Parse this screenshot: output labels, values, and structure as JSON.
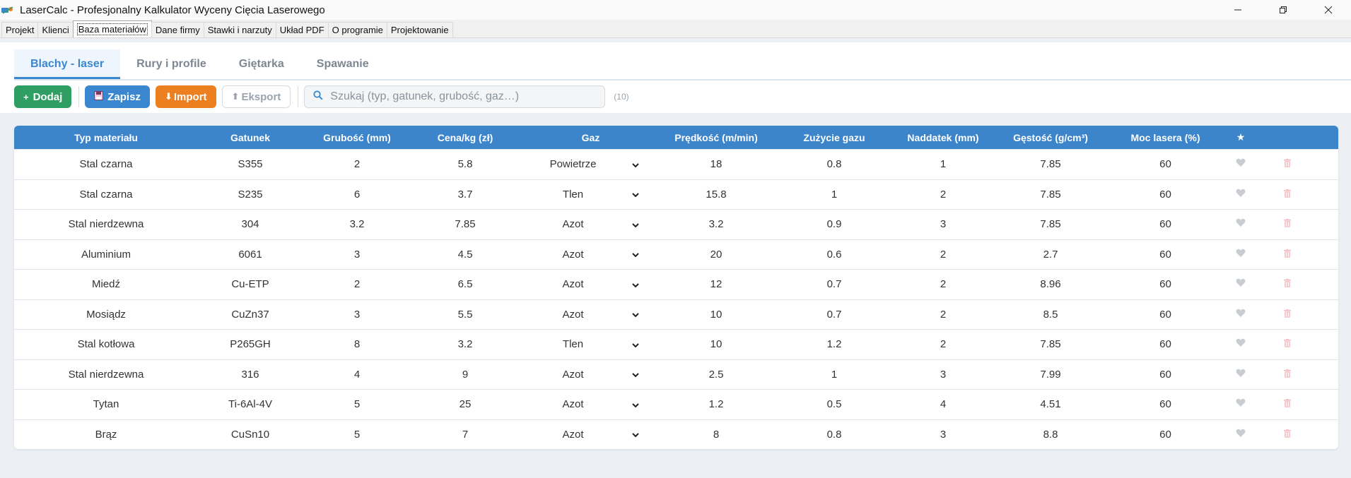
{
  "window": {
    "title": "LaserCalc - Profesjonalny Kalkulator Wyceny Cięcia Laserowego"
  },
  "menu_tabs": [
    {
      "label": "Projekt"
    },
    {
      "label": "Klienci"
    },
    {
      "label": "Baza materiałów",
      "active": true
    },
    {
      "label": "Dane firmy"
    },
    {
      "label": "Stawki i narzuty"
    },
    {
      "label": "Układ PDF"
    },
    {
      "label": "O programie"
    },
    {
      "label": "Projektowanie"
    }
  ],
  "sub_tabs": [
    {
      "label": "Blachy - laser",
      "active": true
    },
    {
      "label": "Rury i profile"
    },
    {
      "label": "Giętarka"
    },
    {
      "label": "Spawanie"
    }
  ],
  "toolbar": {
    "add_label": "Dodaj",
    "save_label": "Zapisz",
    "import_label": "Import",
    "export_label": "Eksport",
    "search_placeholder": "Szukaj (typ, gatunek, grubość, gaz…)",
    "count": "(10)"
  },
  "colors": {
    "accent": "#3d85cb",
    "add": "#2f9e62",
    "import": "#ec7f1f"
  },
  "table": {
    "headers": [
      "Typ materiału",
      "Gatunek",
      "Grubość (mm)",
      "Cena/kg (zł)",
      "Gaz",
      "Prędkość (m/min)",
      "Zużycie gazu",
      "Naddatek (mm)",
      "Gęstość (g/cm³)",
      "Moc lasera (%)",
      "★",
      ""
    ],
    "rows": [
      {
        "typ": "Stal czarna",
        "gatunek": "S355",
        "grubosc": "2",
        "cena": "5.8",
        "gaz": "Powietrze",
        "predkosc": "18",
        "zuzycie": "0.8",
        "naddatek": "1",
        "gestosc": "7.85",
        "moc": "60"
      },
      {
        "typ": "Stal czarna",
        "gatunek": "S235",
        "grubosc": "6",
        "cena": "3.7",
        "gaz": "Tlen",
        "predkosc": "15.8",
        "zuzycie": "1",
        "naddatek": "2",
        "gestosc": "7.85",
        "moc": "60"
      },
      {
        "typ": "Stal nierdzewna",
        "gatunek": "304",
        "grubosc": "3.2",
        "cena": "7.85",
        "gaz": "Azot",
        "predkosc": "3.2",
        "zuzycie": "0.9",
        "naddatek": "3",
        "gestosc": "7.85",
        "moc": "60"
      },
      {
        "typ": "Aluminium",
        "gatunek": "6061",
        "grubosc": "3",
        "cena": "4.5",
        "gaz": "Azot",
        "predkosc": "20",
        "zuzycie": "0.6",
        "naddatek": "2",
        "gestosc": "2.7",
        "moc": "60"
      },
      {
        "typ": "Miedź",
        "gatunek": "Cu-ETP",
        "grubosc": "2",
        "cena": "6.5",
        "gaz": "Azot",
        "predkosc": "12",
        "zuzycie": "0.7",
        "naddatek": "2",
        "gestosc": "8.96",
        "moc": "60"
      },
      {
        "typ": "Mosiądz",
        "gatunek": "CuZn37",
        "grubosc": "3",
        "cena": "5.5",
        "gaz": "Azot",
        "predkosc": "10",
        "zuzycie": "0.7",
        "naddatek": "2",
        "gestosc": "8.5",
        "moc": "60"
      },
      {
        "typ": "Stal kotłowa",
        "gatunek": "P265GH",
        "grubosc": "8",
        "cena": "3.2",
        "gaz": "Tlen",
        "predkosc": "10",
        "zuzycie": "1.2",
        "naddatek": "2",
        "gestosc": "7.85",
        "moc": "60"
      },
      {
        "typ": "Stal nierdzewna",
        "gatunek": "316",
        "grubosc": "4",
        "cena": "9",
        "gaz": "Azot",
        "predkosc": "2.5",
        "zuzycie": "1",
        "naddatek": "3",
        "gestosc": "7.99",
        "moc": "60"
      },
      {
        "typ": "Tytan",
        "gatunek": "Ti-6Al-4V",
        "grubosc": "5",
        "cena": "25",
        "gaz": "Azot",
        "predkosc": "1.2",
        "zuzycie": "0.5",
        "naddatek": "4",
        "gestosc": "4.51",
        "moc": "60"
      },
      {
        "typ": "Brąz",
        "gatunek": "CuSn10",
        "grubosc": "5",
        "cena": "7",
        "gaz": "Azot",
        "predkosc": "8",
        "zuzycie": "0.8",
        "naddatek": "3",
        "gestosc": "8.8",
        "moc": "60"
      }
    ]
  }
}
